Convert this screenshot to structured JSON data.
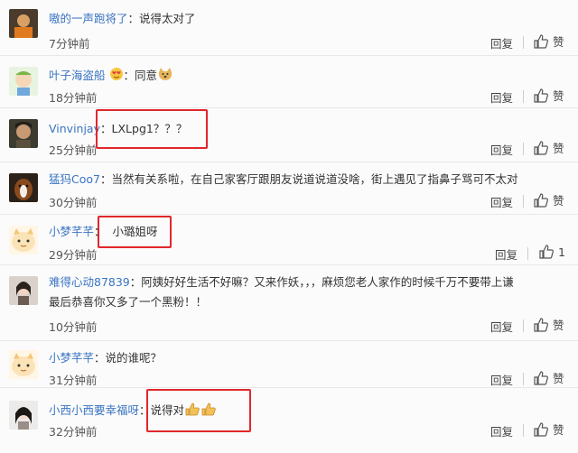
{
  "comments": [
    {
      "user": "嗷的一声跑将了",
      "text": "说得太对了",
      "time": "7分钟前"
    },
    {
      "user": "叶子海盗船",
      "text": "同意",
      "time": "18分钟前"
    },
    {
      "user": "Vinvinjay",
      "text": "LXLpg1？？？",
      "time": "25分钟前"
    },
    {
      "user": "猛犸Coo7",
      "text": "当然有关系啦，在自己家客厅跟朋友说道说道没啥，街上遇见了指鼻子骂可不太对",
      "time": "30分钟前"
    },
    {
      "user": "小梦芊芊",
      "text": "小璐姐呀",
      "time": "29分钟前",
      "likes": "1"
    },
    {
      "user": "难得心动87839",
      "text": "阿姨好好生活不好嘛？又来作妖，，，麻烦您老人家作的时候千万不要带上谦",
      "text2": "最后恭喜你又多了一个黑粉！！",
      "time": "10分钟前"
    },
    {
      "user": "小梦芊芊",
      "text": "说的谁呢？",
      "time": "31分钟前"
    },
    {
      "user": "小西小西要幸福呀",
      "text": "说得对",
      "time": "32分钟前"
    }
  ],
  "actions": {
    "reply_label": "回复",
    "like_label": "赞"
  },
  "colors": {
    "username": "#3a74c2",
    "highlight_box": "#e0272b"
  }
}
